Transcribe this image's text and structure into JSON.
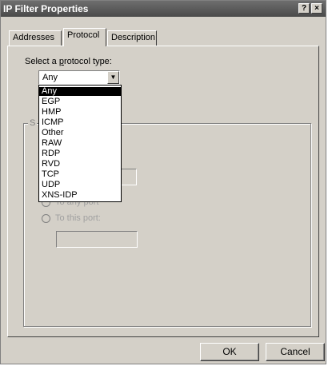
{
  "window": {
    "title": "IP Filter Properties",
    "help_label": "?",
    "close_label": "×"
  },
  "tabs": [
    {
      "label": "Addresses",
      "active": false
    },
    {
      "label": "Protocol",
      "active": true
    },
    {
      "label": "Description",
      "active": false
    }
  ],
  "protocol": {
    "label_prefix": "Select a ",
    "label_underlined": "p",
    "label_suffix": "rotocol type:",
    "selected": "Any",
    "options": [
      "Any",
      "EGP",
      "HMP",
      "ICMP",
      "Other",
      "RAW",
      "RDP",
      "RVD",
      "TCP",
      "UDP",
      "XNS-IDP"
    ]
  },
  "port_group": {
    "label": "S",
    "to_any_port": "To any port",
    "to_this_port": "To this port:"
  },
  "buttons": {
    "ok": "OK",
    "cancel": "Cancel"
  }
}
